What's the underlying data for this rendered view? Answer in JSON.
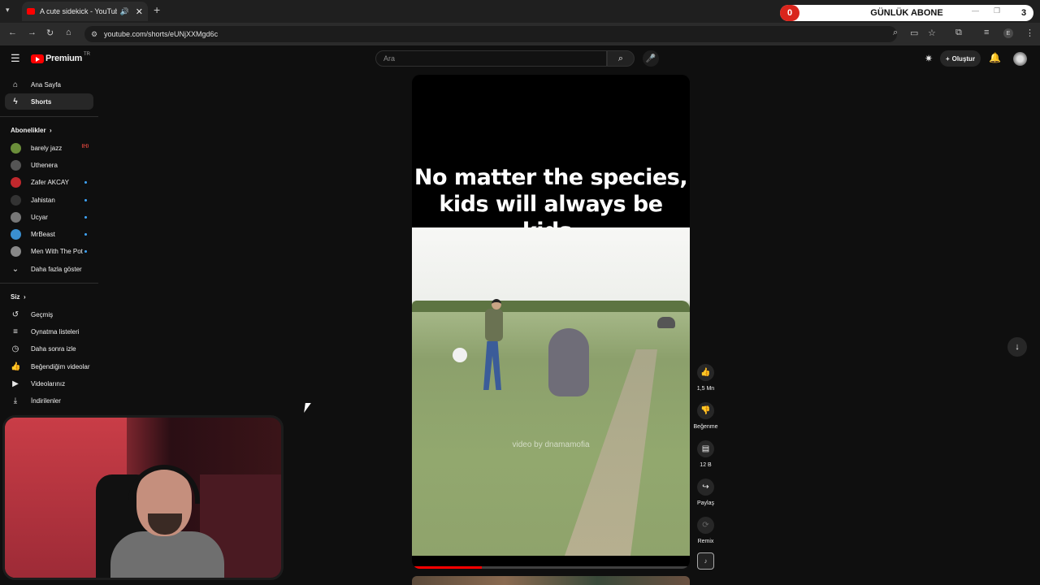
{
  "browser": {
    "tab_title": "A cute sidekick - YouTube",
    "url": "youtube.com/shorts/eUNjXXMgd6c",
    "profile_letter": "E"
  },
  "sub_counter": {
    "left_value": "0",
    "title": "GÜNLÜK ABONE",
    "right_value": "3"
  },
  "header": {
    "logo_text": "Premium",
    "logo_region": "TR",
    "search_placeholder": "Ara",
    "create_label": "Oluştur"
  },
  "sidebar": {
    "main": [
      {
        "label": "Ana Sayfa",
        "icon": "home-icon"
      },
      {
        "label": "Shorts",
        "icon": "shorts-icon",
        "active": true
      }
    ],
    "subs_heading": "Abonelikler",
    "subscriptions": [
      {
        "label": "barely jazz",
        "color": "#6b8e3a",
        "badge": "live"
      },
      {
        "label": "Uthenera",
        "color": "#555555"
      },
      {
        "label": "Zafer AKCAY",
        "color": "#c0282d",
        "badge": "dot"
      },
      {
        "label": "Jahistan",
        "color": "#333333",
        "badge": "dot"
      },
      {
        "label": "Ucyar",
        "color": "#777777",
        "badge": "dot"
      },
      {
        "label": "MrBeast",
        "color": "#3a8fd0",
        "badge": "dot"
      },
      {
        "label": "Men With The Pot",
        "color": "#888888",
        "badge": "dot"
      }
    ],
    "show_more": "Daha fazla göster",
    "you_heading": "Siz",
    "you_items": [
      {
        "label": "Geçmiş",
        "icon": "history-icon"
      },
      {
        "label": "Oynatma listeleri",
        "icon": "playlist-icon"
      },
      {
        "label": "Daha sonra izle",
        "icon": "clock-icon"
      },
      {
        "label": "Beğendiğim videolar",
        "icon": "thumbs-up-icon"
      },
      {
        "label": "Videolarınız",
        "icon": "video-icon"
      },
      {
        "label": "İndirilenler",
        "icon": "download-icon"
      }
    ]
  },
  "video": {
    "caption_line1": "No matter the species,",
    "caption_line2": "kids will always be kids.",
    "watermark": "video by dnamamofia",
    "progress": 0.25
  },
  "actions": {
    "like_count": "1,5 Mn",
    "dislike_label": "Beğenme",
    "comments_count": "12 B",
    "share_label": "Paylaş",
    "remix_label": "Remix"
  }
}
